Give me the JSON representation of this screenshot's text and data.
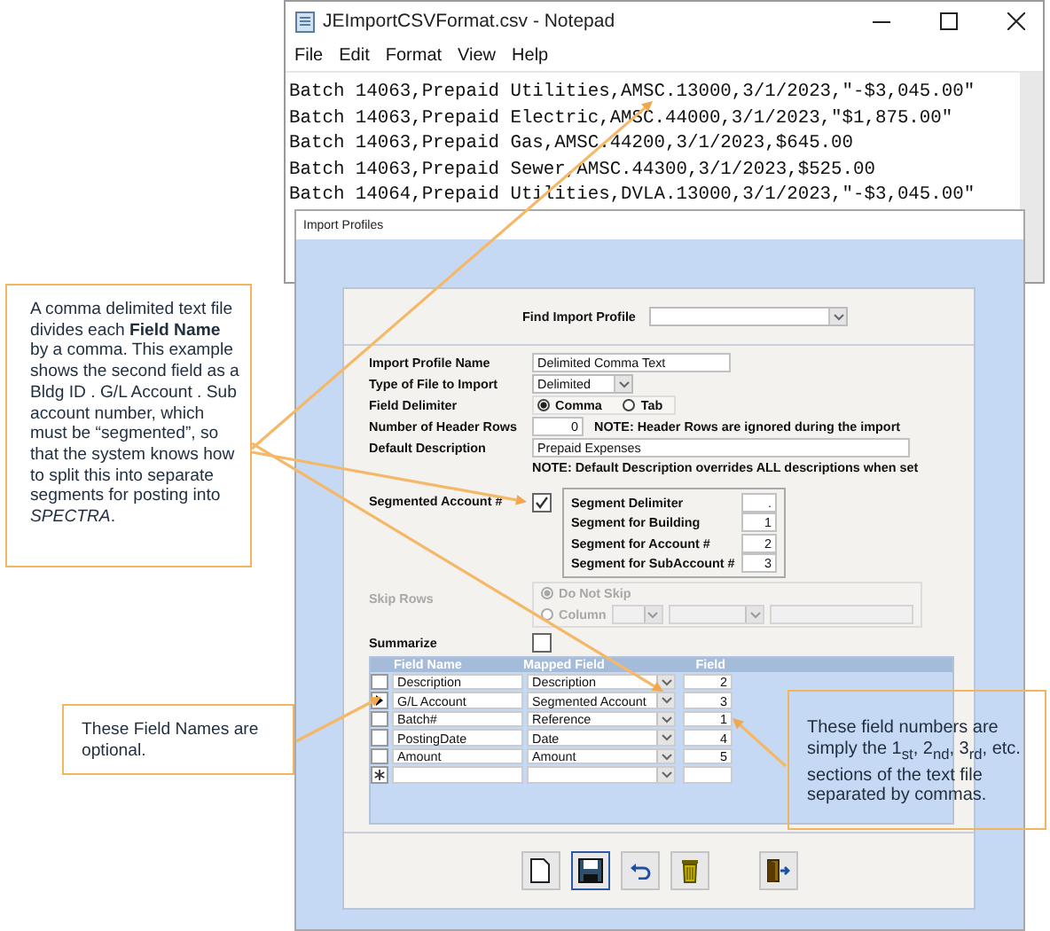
{
  "notepad": {
    "title": "JEImportCSVFormat.csv - Notepad",
    "menu": [
      "File",
      "Edit",
      "Format",
      "View",
      "Help"
    ],
    "lines": [
      "Batch 14063,Prepaid Utilities,AMSC.13000,3/1/2023,\"-$3,045.00\"",
      "Batch 14063,Prepaid Electric,AMSC.44000,3/1/2023,\"$1,875.00\"",
      "Batch 14063,Prepaid Gas,AMSC.44200,3/1/2023,$645.00",
      "Batch 14063,Prepaid Sewer,AMSC.44300,3/1/2023,$525.00",
      "Batch 14064,Prepaid Utilities,DVLA.13000,3/1/2023,\"-$3,045.00\""
    ]
  },
  "dialog": {
    "title": "Import Profiles",
    "find_label": "Find Import Profile",
    "fields": [
      {
        "kind": "text",
        "label": "Import Profile Name",
        "value": "Delimited Comma Text"
      },
      {
        "kind": "select",
        "label": "Type of File to Import",
        "value": "Delimited"
      },
      {
        "kind": "radio",
        "label": "Field Delimiter",
        "options": [
          {
            "label": "Comma",
            "selected": true
          },
          {
            "label": "Tab",
            "selected": false
          }
        ]
      },
      {
        "kind": "number",
        "label": "Number of Header Rows",
        "value": "0",
        "note": "NOTE: Header Rows are ignored during the import"
      },
      {
        "kind": "wide",
        "label": "Default Description",
        "value": "Prepaid Expenses"
      }
    ],
    "description_note": "NOTE: Default Description overrides ALL descriptions when set",
    "segmented": {
      "label": "Segmented Account #",
      "checked": true,
      "segments": [
        {
          "label": "Segment Delimiter",
          "value": "."
        },
        {
          "label": "Segment for Building",
          "value": "1"
        },
        {
          "label": "Segment for Account #",
          "value": "2"
        },
        {
          "label": "Segment for SubAccount #",
          "value": "3"
        }
      ]
    },
    "skip_rows": {
      "label": "Skip Rows",
      "disabled": true,
      "options": [
        {
          "label": "Do Not Skip",
          "selected": true
        },
        {
          "label": "Column",
          "selected": false
        }
      ]
    },
    "summarize": {
      "label": "Summarize",
      "checked": false
    },
    "grid": {
      "columns": [
        "Field Name",
        "Mapped Field",
        "Field"
      ],
      "rows": [
        {
          "name": "Description",
          "mapped": "Description",
          "field": "2",
          "current": false
        },
        {
          "name": "G/L Account",
          "mapped": "Segmented Account",
          "field": "3",
          "current": true
        },
        {
          "name": "Batch#",
          "mapped": "Reference",
          "field": "1",
          "current": false
        },
        {
          "name": "PostingDate",
          "mapped": "Date",
          "field": "4",
          "current": false
        },
        {
          "name": "Amount",
          "mapped": "Amount",
          "field": "5",
          "current": false
        }
      ]
    }
  },
  "callouts": [
    {
      "text": "A comma delimited text file divides each **Field Name** by a comma. This example shows the second field as a Bldg ID . G/L Account . Sub account number, which must be “segmented”, so that the system knows how to split this into separate segments for posting into *SPECTRA*."
    },
    {
      "text": "These Field Names are optional."
    },
    {
      "text": "These field numbers are simply the 1$_{st}$, 2$_{nd}$, 3$_{rd}$, etc. sections of the text file separated by commas."
    }
  ]
}
